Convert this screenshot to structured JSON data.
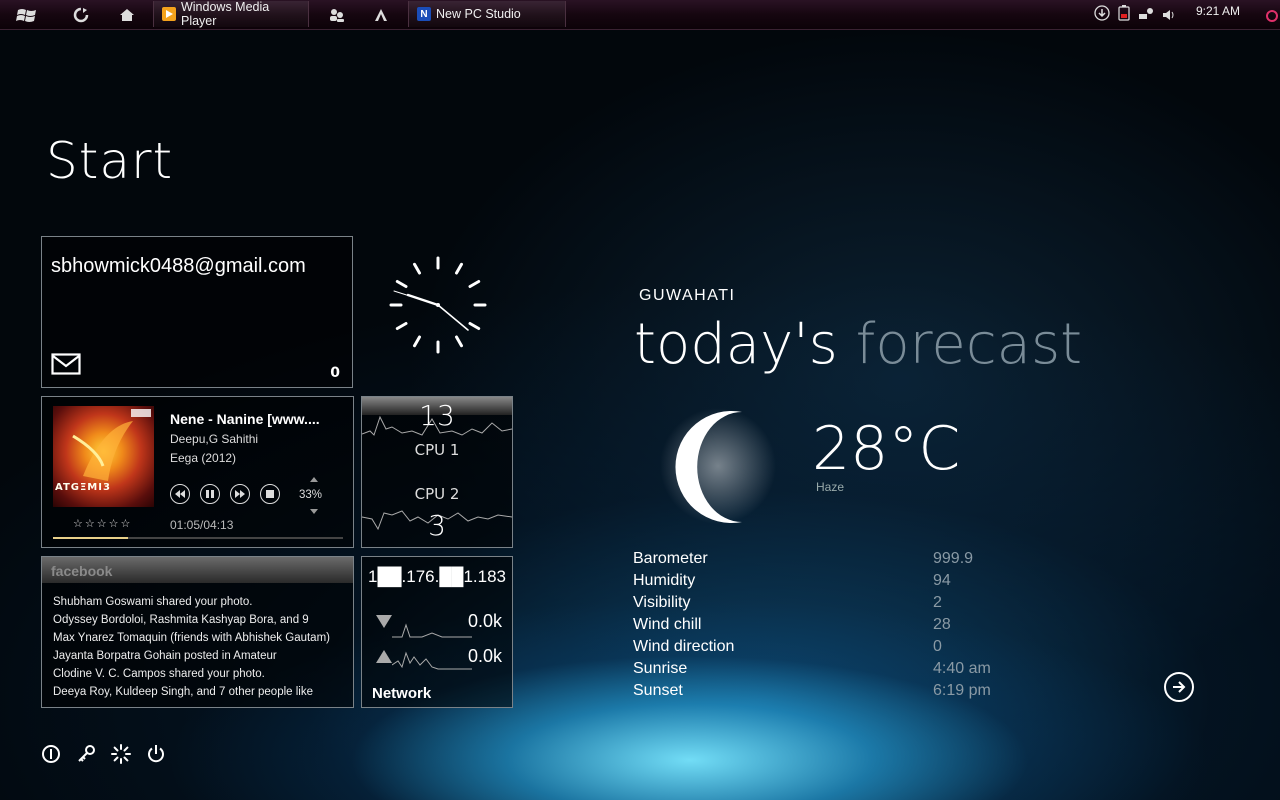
{
  "taskbar": {
    "tasks": [
      {
        "label": "Windows Media Player",
        "icon": "media-player-icon",
        "color": "#f4a21c"
      },
      {
        "label": "New PC Studio",
        "icon": "pc-studio-icon",
        "color": "#1a4db8"
      }
    ],
    "clock": "9:21 AM"
  },
  "start": {
    "title": "Start"
  },
  "mail": {
    "address": "sbhowmick0488@gmail.com",
    "count": "0"
  },
  "media": {
    "title": "Nene - Nanine [www....",
    "artist": "Deepu,G Sahithi",
    "album": "Eega (2012)",
    "volume": "33%",
    "time": "01:05/04:13",
    "rating": "☆☆☆☆☆",
    "progress": 0.26,
    "album_art_text": "ATGΞMI3"
  },
  "cpu": {
    "cpu1_value": "13",
    "cpu1_label": "CPU 1",
    "cpu2_label": "CPU 2",
    "cpu2_value": "3"
  },
  "facebook": {
    "title": "facebook",
    "items": [
      "Shubham Goswami shared your photo.",
      "Odyssey Bordoloi, Rashmita Kashyap Bora, and 9",
      "Max Ynarez Tomaquin (friends with Abhishek Gautam)",
      "Jayanta Borpatra Gohain posted in Amateur",
      "Clodine V. C. Campos shared your photo.",
      "Deeya Roy, Kuldeep Singh, and 7 other people like"
    ]
  },
  "network": {
    "ip": "1██.176.██1.183",
    "down": "0.0k",
    "up": "0.0k",
    "label": "Network"
  },
  "weather": {
    "city": "GUWAHATI",
    "heading_main": "today's",
    "heading_dim": "forecast",
    "temperature": "28°C",
    "condition": "Haze",
    "details": [
      {
        "label": "Barometer",
        "value": "999.9"
      },
      {
        "label": "Humidity",
        "value": "94"
      },
      {
        "label": "Visibility",
        "value": "2"
      },
      {
        "label": "Wind chill",
        "value": "28"
      },
      {
        "label": "Wind direction",
        "value": "0"
      },
      {
        "label": "Sunrise",
        "value": "4:40 am"
      },
      {
        "label": "Sunset",
        "value": "6:19 pm"
      }
    ]
  }
}
